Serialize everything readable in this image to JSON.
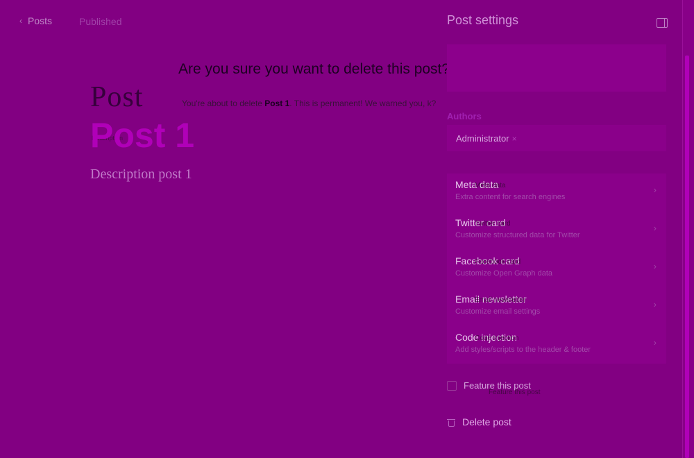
{
  "editor": {
    "back_label": "Posts",
    "status": "Published",
    "ghost_title": "Post",
    "ghost_subtitle": "Description",
    "title": "Post 1",
    "description": "Description post 1"
  },
  "modal": {
    "title": "Are you sure you want to delete this post?",
    "body_prefix": "You're about to delete ",
    "body_post": "Post 1",
    "body_suffix": ". This is permanent! We warned you, k?"
  },
  "settings": {
    "title": "Post settings",
    "authors_label": "Authors",
    "author": "Administrator",
    "author_remove": "×",
    "menu": [
      {
        "title": "Meta data",
        "desc": "Extra content for search engines",
        "ghost": "Meta data"
      },
      {
        "title": "Twitter card",
        "desc": "Customize structured data for Twitter",
        "ghost": "Twitter card"
      },
      {
        "title": "Facebook card",
        "desc": "Customize Open Graph data",
        "ghost": "Facebook card"
      },
      {
        "title": "Email newsletter",
        "desc": "Customize email settings",
        "ghost": "Email newsletter"
      },
      {
        "title": "Code injection",
        "desc": "Add styles/scripts to the header & footer",
        "ghost": "Code injection"
      }
    ],
    "feature_label": "Feature this post",
    "delete_label": "Delete post"
  },
  "colors": {
    "background": "#820082",
    "accent": "#b000b8"
  }
}
